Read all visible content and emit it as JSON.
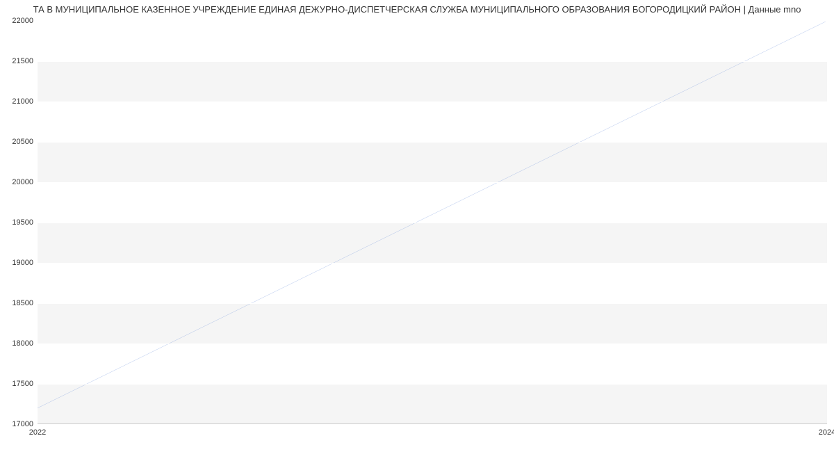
{
  "chart_data": {
    "type": "line",
    "title": "ТА В МУНИЦИПАЛЬНОЕ КАЗЕННОЕ УЧРЕЖДЕНИЕ ЕДИНАЯ ДЕЖУРНО-ДИСПЕТЧЕРСКАЯ СЛУЖБА МУНИЦИПАЛЬНОГО ОБРАЗОВАНИЯ БОГОРОДИЦКИЙ РАЙОН | Данные mno",
    "x": [
      2022,
      2024
    ],
    "values": [
      17200,
      22000
    ],
    "xlabel": "",
    "ylabel": "",
    "ylim": [
      17000,
      22000
    ],
    "xlim": [
      2022,
      2024
    ],
    "y_ticks": [
      17000,
      17500,
      18000,
      18500,
      19000,
      19500,
      20000,
      20500,
      21000,
      21500,
      22000
    ],
    "x_ticks": [
      2022,
      2024
    ],
    "line_color": "#6b8fd9"
  }
}
